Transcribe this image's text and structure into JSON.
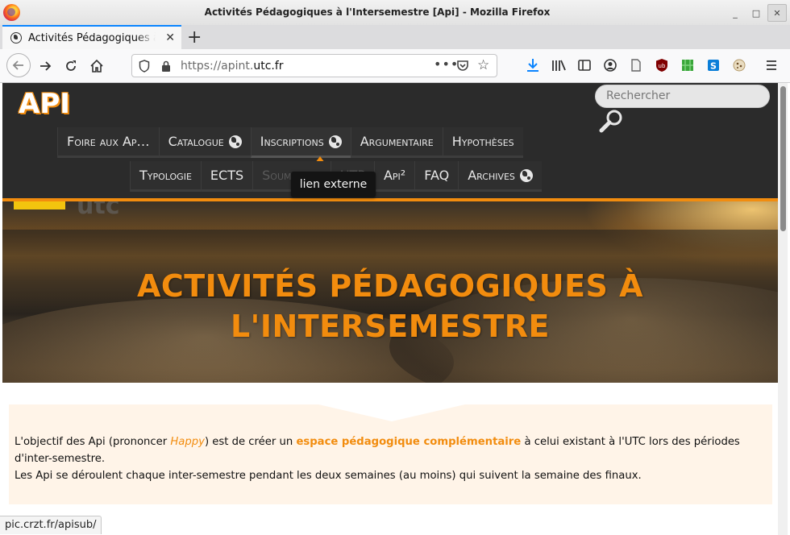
{
  "window": {
    "title": "Activités Pédagogiques à l'Intersemestre [Api] - Mozilla Firefox",
    "minimize": "_",
    "maximize": "□",
    "close": "✕"
  },
  "tab": {
    "title": "Activités Pédagogiques à l'Intersemestre [Api]",
    "close": "✕",
    "new_tab": "+"
  },
  "urlbar": {
    "prefix": "https://apint.",
    "domain": "utc.fr",
    "more": "•••",
    "star": "☆"
  },
  "site": {
    "logo": "API",
    "search_placeholder": "Rechercher",
    "menu_row1": [
      {
        "label": "Foire aux Ap…",
        "external": false
      },
      {
        "label": "Catalogue",
        "external": true
      },
      {
        "label": "Inscriptions",
        "external": true,
        "active": true
      },
      {
        "label": "Argumentaire",
        "external": false
      },
      {
        "label": "Hypothèses",
        "external": false
      }
    ],
    "menu_row2": [
      {
        "label": "Typologie",
        "external": false
      },
      {
        "label": "ECTS",
        "external": false
      },
      {
        "label": "Soumission",
        "external": false
      },
      {
        "label": "UTP",
        "external": false
      },
      {
        "label": "Api²",
        "external": false
      },
      {
        "label": "FAQ",
        "external": false
      },
      {
        "label": "Archives",
        "external": true
      }
    ],
    "tooltip": "lien externe",
    "hero_logo_text": "utc",
    "hero_title_line1": "ACTIVITÉS PÉDAGOGIQUES À",
    "hero_title_line2": "L'INTERSEMESTRE",
    "intro": {
      "p1_a": "L'objectif des Api (prononcer ",
      "p1_happy": "Happy",
      "p1_b": ") est de créer un ",
      "p1_hl": "espace pédagogique complémentaire",
      "p1_c": " à celui existant à l'UTC lors des périodes d'inter-semestre.",
      "p2": "Les Api se déroulent chaque inter-semestre pendant les deux semaines (au moins) qui suivent la semaine des finaux."
    }
  },
  "status_url": "pic.crzt.fr/apisub/",
  "colors": {
    "accent": "#f28c0e",
    "header_bg": "#2b2b2b",
    "intro_bg": "#fff4e8",
    "firefox_blue": "#0a84ff"
  }
}
